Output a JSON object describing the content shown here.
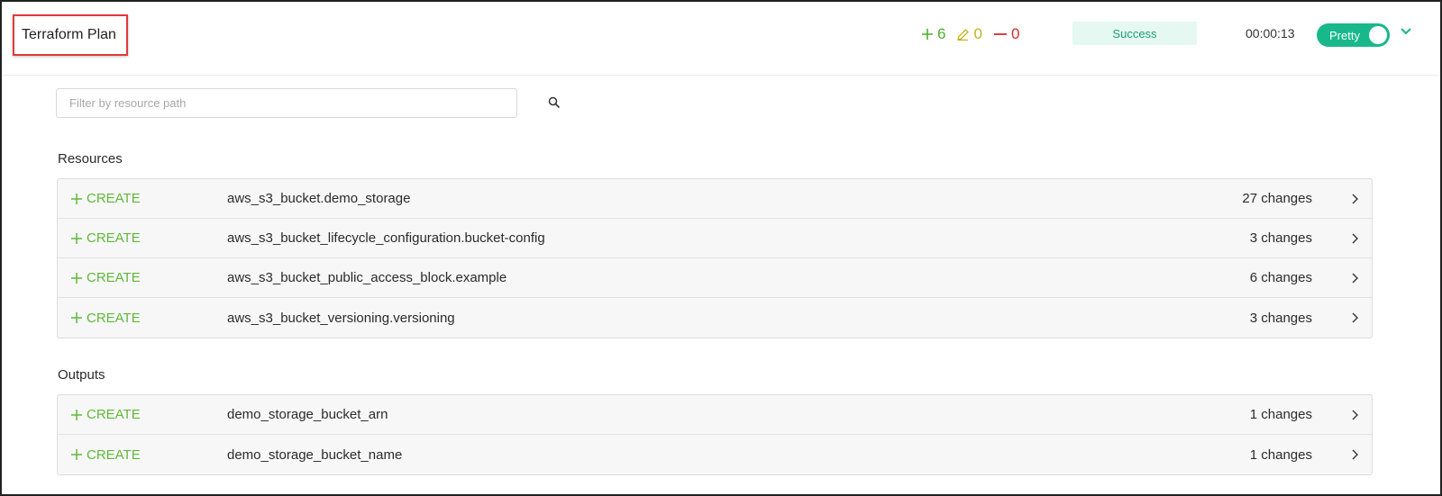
{
  "header": {
    "title": "Terraform Plan",
    "counts": {
      "add": "6",
      "change": "0",
      "destroy": "0"
    },
    "status": "Success",
    "duration": "00:00:13",
    "toggle_label": "Pretty"
  },
  "search": {
    "placeholder": "Filter by resource path",
    "value": ""
  },
  "resources": {
    "title": "Resources",
    "rows": [
      {
        "action": "CREATE",
        "name": "aws_s3_bucket.demo_storage",
        "changes": "27 changes"
      },
      {
        "action": "CREATE",
        "name": "aws_s3_bucket_lifecycle_configuration.bucket-config",
        "changes": "3 changes"
      },
      {
        "action": "CREATE",
        "name": "aws_s3_bucket_public_access_block.example",
        "changes": "6 changes"
      },
      {
        "action": "CREATE",
        "name": "aws_s3_bucket_versioning.versioning",
        "changes": "3 changes"
      }
    ]
  },
  "outputs": {
    "title": "Outputs",
    "rows": [
      {
        "action": "CREATE",
        "name": "demo_storage_bucket_arn",
        "changes": "1 changes"
      },
      {
        "action": "CREATE",
        "name": "demo_storage_bucket_name",
        "changes": "1 changes"
      }
    ]
  },
  "colors": {
    "add": "#4caf2a",
    "change": "#c4b21c",
    "destroy": "#d42c2c",
    "success_text": "#1d9e74",
    "toggle_bg": "#18b88a",
    "highlight": "#e03a3a"
  },
  "icons": [
    "plus-icon",
    "pencil-icon",
    "minus-icon",
    "search-icon",
    "chevron-right-icon",
    "chevron-down-icon"
  ]
}
